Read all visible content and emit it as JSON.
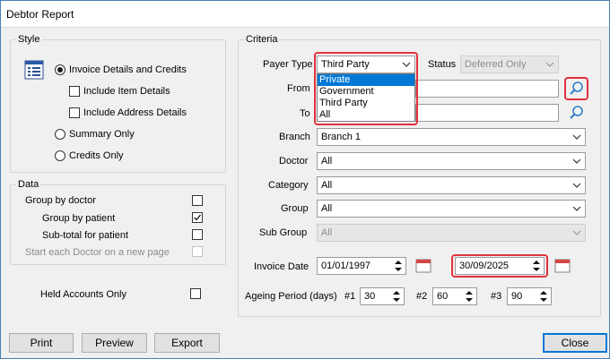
{
  "window": {
    "title": "Debtor Report"
  },
  "style": {
    "legend": "Style",
    "invoice_details": "Invoice Details and Credits",
    "include_item": "Include Item Details",
    "include_address": "Include Address Details",
    "summary_only": "Summary Only",
    "credits_only": "Credits Only"
  },
  "data": {
    "legend": "Data",
    "group_by_doctor": "Group by doctor",
    "group_by_patient": "Group by patient",
    "subtotal_patient": "Sub-total for patient",
    "start_each_doctor": "Start each Doctor on a new page"
  },
  "held": {
    "label": "Held Accounts Only"
  },
  "criteria": {
    "legend": "Criteria",
    "payer_type_label": "Payer Type",
    "payer_type_value": "Third Party",
    "payer_options": [
      "Private",
      "Government",
      "Third Party",
      "All"
    ],
    "status_label": "Status",
    "status_value": "Deferred Only",
    "from_label": "From",
    "to_label": "To",
    "branch_label": "Branch",
    "branch_value": "Branch 1",
    "doctor_label": "Doctor",
    "doctor_value": "All",
    "category_label": "Category",
    "category_value": "All",
    "group_label": "Group",
    "group_value": "All",
    "subgroup_label": "Sub Group",
    "subgroup_value": "All",
    "invoice_date_label": "Invoice Date",
    "invoice_date_from": "01/01/1997",
    "invoice_date_to": "30/09/2025",
    "ageing_label": "Ageing Period (days)",
    "ageing1_label": "#1",
    "ageing1_value": "30",
    "ageing2_label": "#2",
    "ageing2_value": "60",
    "ageing3_label": "#3",
    "ageing3_value": "90"
  },
  "buttons": {
    "print": "Print",
    "preview": "Preview",
    "export": "Export",
    "close": "Close"
  },
  "colors": {
    "highlight": "#e0323c",
    "selection": "#0078d7",
    "window_border": "#4a7fb8"
  }
}
